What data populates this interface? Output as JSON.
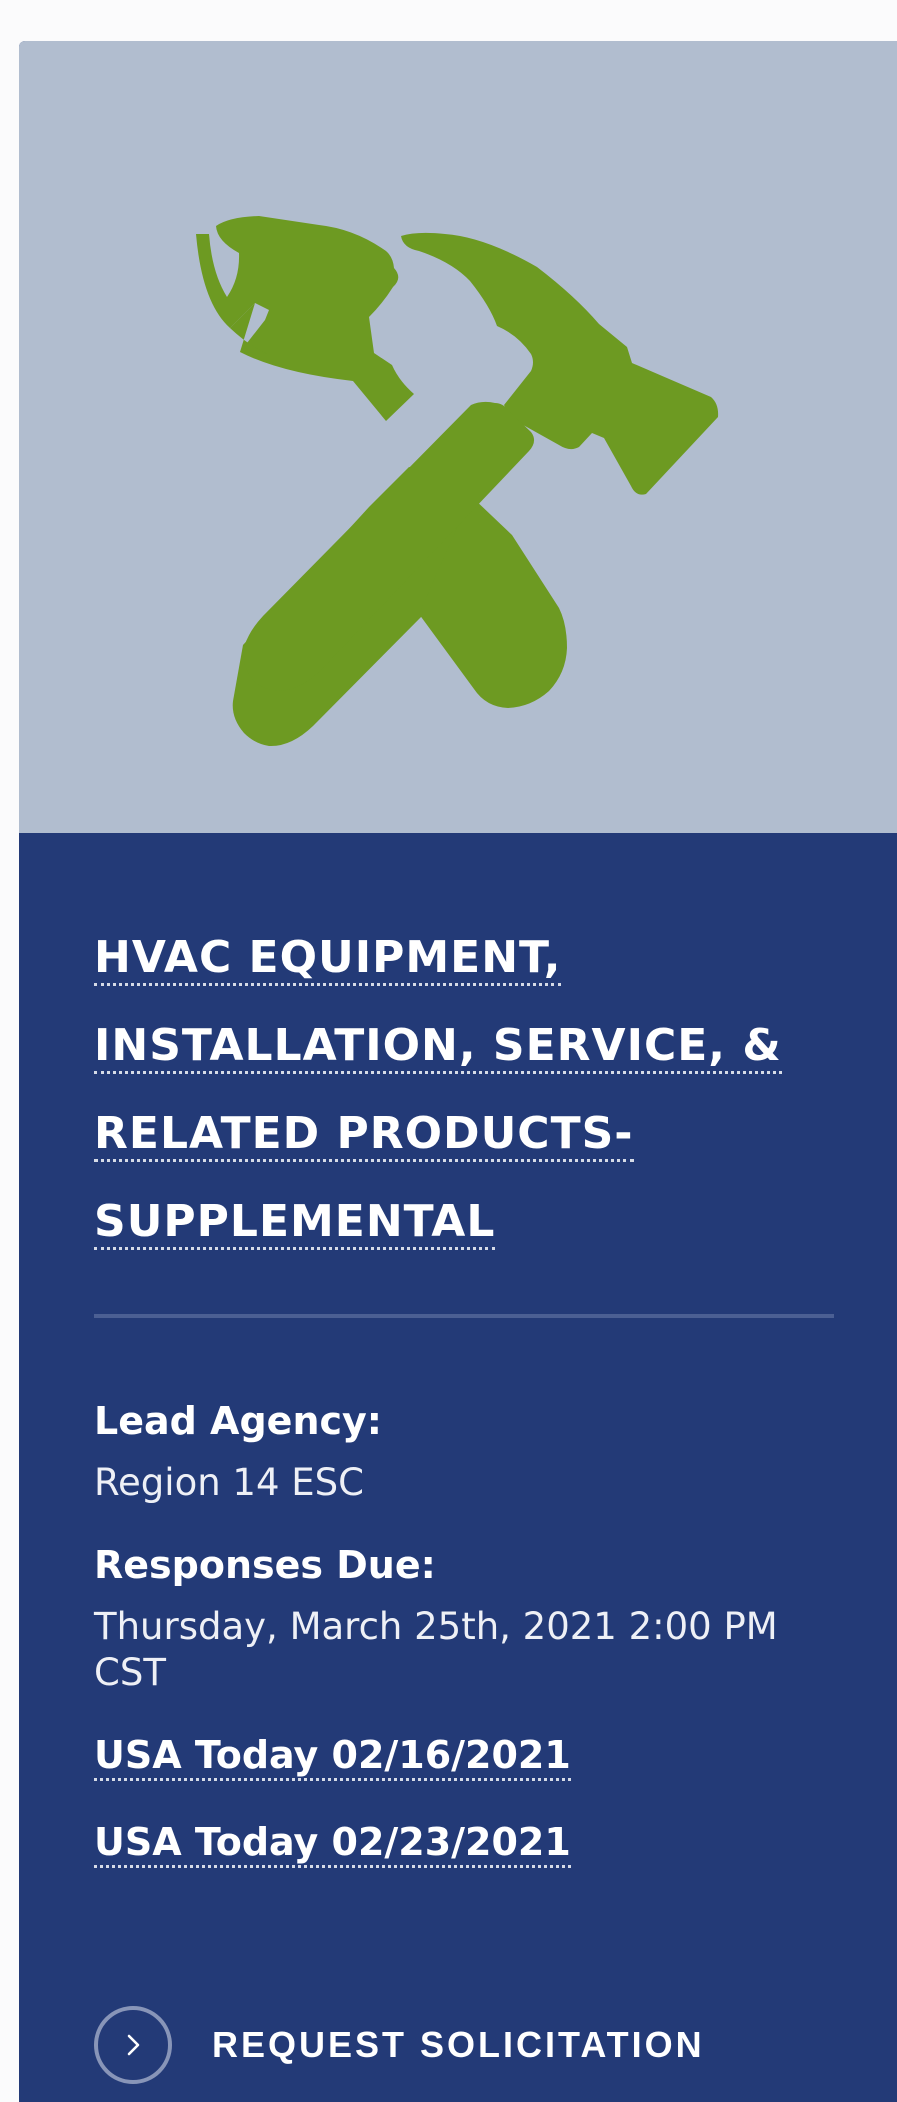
{
  "card": {
    "image_icon": "tools-icon",
    "colors": {
      "hero_background": "#b1bdcf",
      "icon": "#6d9a22",
      "card_background": "#233a77"
    },
    "title_lines": [
      "HVAC EQUIPMENT,",
      "INSTALLATION, SERVICE, &",
      "RELATED PRODUCTS-",
      "SUPPLEMENTAL"
    ],
    "lead_agency": {
      "label": "Lead Agency:",
      "value": "Region 14 ESC"
    },
    "responses_due": {
      "label": "Responses Due:",
      "value": "Thursday, March 25th, 2021 2:00 PM CST"
    },
    "links": [
      "USA Today 02/16/2021",
      "USA Today 02/23/2021"
    ],
    "cta": {
      "icon": "chevron-right-icon",
      "label": "REQUEST SOLICITATION"
    }
  }
}
